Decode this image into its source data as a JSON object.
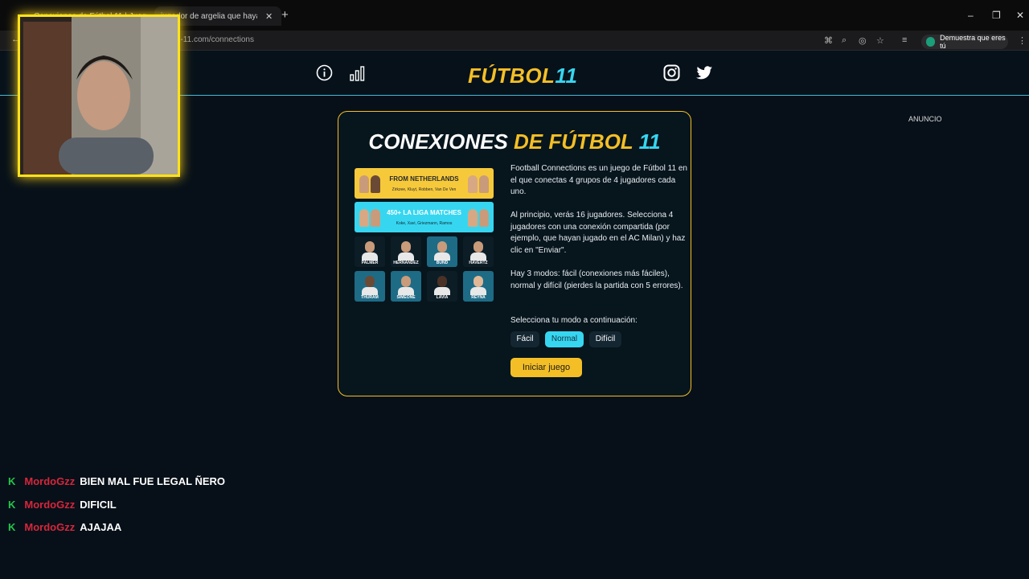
{
  "browser": {
    "tabs": [
      {
        "label": "Conexiones de Fútbol 11 | Juego"
      },
      {
        "label": "jugador de argelia que haya jugado"
      }
    ],
    "new_tab": "+",
    "url": "futbol-11.com/connections",
    "profile_label": "Demuestra que eres tú",
    "window_controls": {
      "minimize": "–",
      "maximize": "❐",
      "close": "✕"
    }
  },
  "header": {
    "logo_main": "FÚTBOL",
    "logo_num": "11",
    "icons": [
      "info-icon",
      "stats-icon",
      "instagram-icon",
      "twitter-icon"
    ]
  },
  "ad_label": "ANUNCIO",
  "card": {
    "title_white": "CONEXIONES",
    "title_yellow": "DE FÚTBOL",
    "title_cyan": "11",
    "banners": [
      {
        "title": "FROM NETHERLANDS",
        "subtitle": "Zirkzee, Kluyt, Robben, Van De Ven"
      },
      {
        "title": "450+ LA LIGA MATCHES",
        "subtitle": "Koke, Xavi, Griezmann, Ramos"
      }
    ],
    "players": [
      "PALMER",
      "HERNANDEZ",
      "BUND",
      "HAVERTZ",
      "THURAM",
      "SIMEONE",
      "LAVIA",
      "REYNA"
    ],
    "paragraph1": "Football Connections es un juego de Fútbol 11 en el que conectas 4 grupos de 4 jugadores cada uno.",
    "paragraph2": "Al principio, verás 16 jugadores. Selecciona 4 jugadores con una conexión compartida (por ejemplo, que hayan jugado en el AC Milan) y haz clic en \"Enviar\".",
    "paragraph3": "Hay 3 modos: fácil (conexiones más fáciles), normal y difícil (pierdes la partida con 5 errores).",
    "mode_prompt": "Selecciona tu modo a continuación:",
    "modes": [
      "Fácil",
      "Normal",
      "Difícil"
    ],
    "selected_mode": "Normal",
    "start_button": "Iniciar juego"
  },
  "chat": [
    {
      "badge": "K",
      "user": "MordoGzz",
      "message": "BIEN MAL FUE LEGAL ÑERO"
    },
    {
      "badge": "K",
      "user": "MordoGzz",
      "message": "DIFICIL"
    },
    {
      "badge": "K",
      "user": "MordoGzz",
      "message": "AJAJAA"
    }
  ],
  "colors": {
    "accent_yellow": "#f4bf26",
    "accent_cyan": "#37d6f0",
    "page_bg": "#071019",
    "chat_user": "#d7263b"
  }
}
